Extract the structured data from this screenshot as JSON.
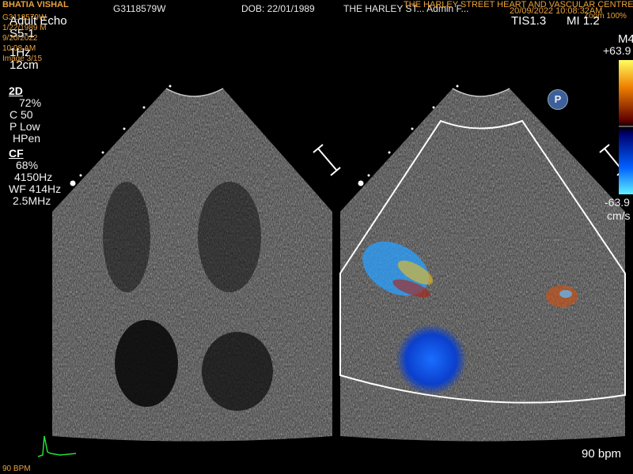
{
  "header": {
    "patient_id": "G3118579W",
    "dob": "DOB: 22/01/1989",
    "clinic_short": "THE HARLEY ST... Admin F...",
    "clinic_full": "THE HARLEY STREET HEART AND VASCULAR CENTRE",
    "date_time": "20/09/2022    10:08:32AM",
    "zoom": "Zoom 100%"
  },
  "overlay_top_left": {
    "name": "BHATIA VISHAL",
    "id": "G3118579W",
    "dob": "1/22/1989  M",
    "date": "9/20/2022",
    "time": "10:08 AM",
    "image": "Image 3/15"
  },
  "preset": {
    "name": "Adult Echo",
    "probe": "S5-1",
    "freq": "1Hz",
    "depth": "12cm"
  },
  "mode_2d": {
    "label": "2D",
    "gain": "72%",
    "compress": "C 50",
    "power": "P Low",
    "harmonic": "HPen"
  },
  "mode_cf": {
    "label": "CF",
    "gain": "68%",
    "prf": "4150Hz",
    "wall_filter": "WF 414Hz",
    "freq": "2.5MHz"
  },
  "indices": {
    "tis": "TIS1.3",
    "mi": "MI 1.2"
  },
  "color_scale": {
    "map": "M4",
    "top": "+63.9",
    "bottom": "-63.9",
    "unit": "cm/s"
  },
  "heart_rate": "90 bpm",
  "ecg_rate": "90 BPM",
  "p_badge": "P"
}
